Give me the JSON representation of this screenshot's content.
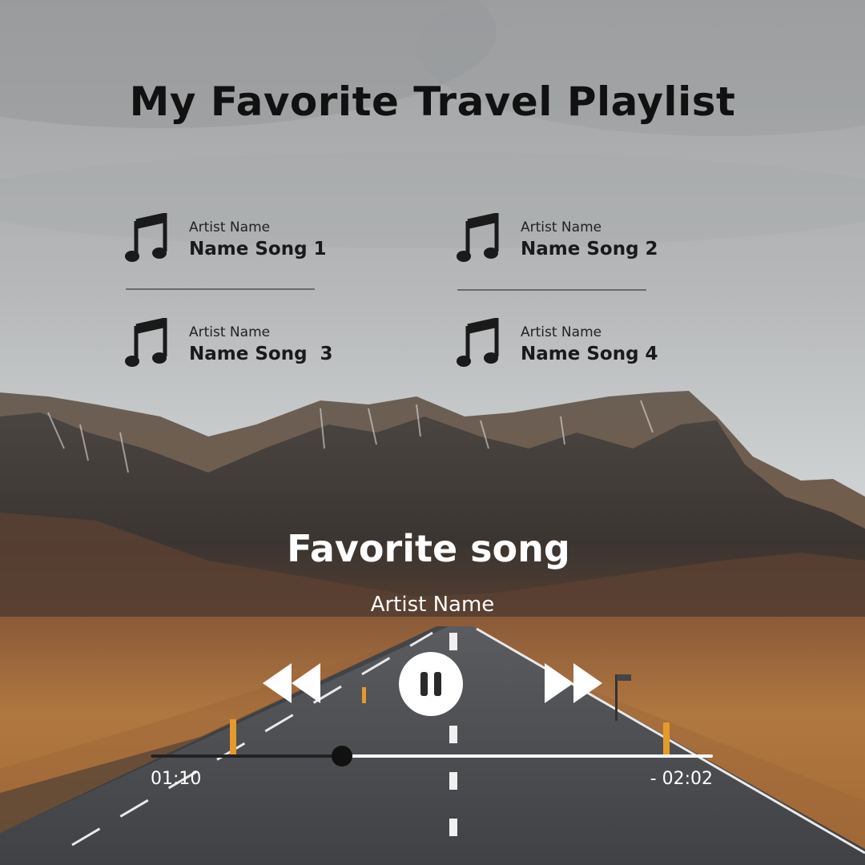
{
  "header": {
    "title": "My Favorite Travel Playlist"
  },
  "playlist": {
    "items": [
      {
        "artist": "Artist Name",
        "song": "Name Song 1",
        "icon": "music-note-icon"
      },
      {
        "artist": "Artist Name",
        "song": "Name Song 2",
        "icon": "music-note-icon"
      },
      {
        "artist": "Artist Name",
        "song": "Name Song  3",
        "icon": "music-note-icon"
      },
      {
        "artist": "Artist Name",
        "song": "Name Song 4",
        "icon": "music-note-icon"
      }
    ]
  },
  "player": {
    "song_title": "Favorite song",
    "artist": "Artist Name",
    "elapsed": "01:10",
    "remaining": "- 02:02",
    "progress": 0.34,
    "controls": {
      "rewind": "rewind-icon",
      "pause": "pause-icon",
      "forward": "fast-forward-icon"
    }
  },
  "colors": {
    "sky_top": "#a6a8a9",
    "sky_bottom": "#c9cbcc",
    "mountain_dark": "#3b3733",
    "field": "#a8683a",
    "road": "#4b4d50",
    "text_dark": "#111111",
    "text_light": "#ffffff"
  }
}
